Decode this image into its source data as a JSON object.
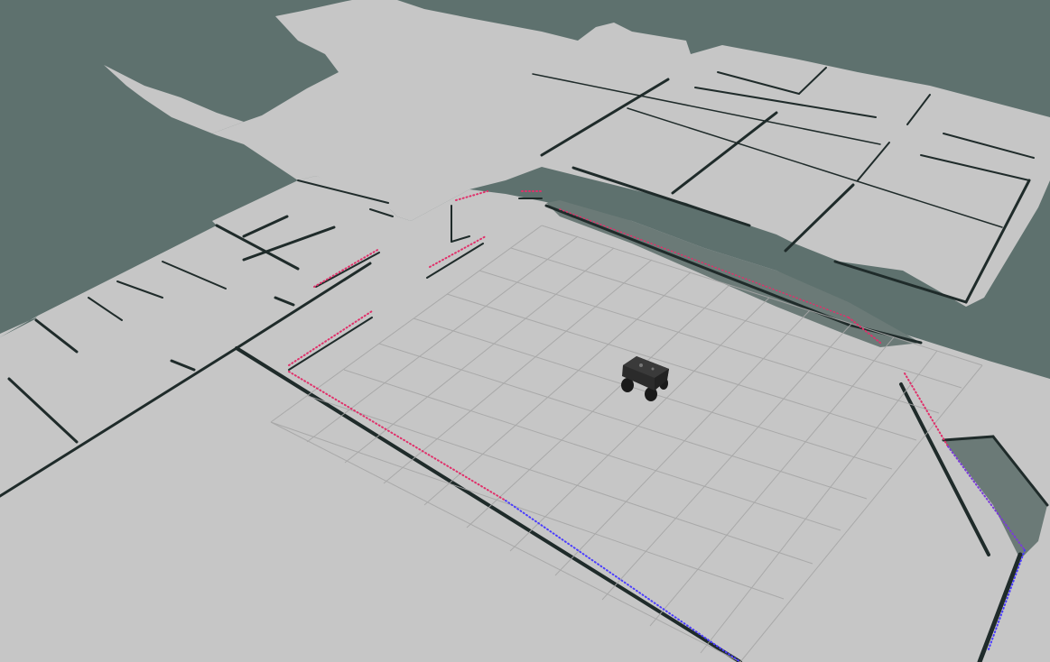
{
  "viewport": {
    "kind": "3d-map-visualization",
    "has_text": false
  },
  "colors": {
    "unknown": "#5e716e",
    "free": "#c6c6c6",
    "wall": "#1f2b2a",
    "grid": "#a6a6a6",
    "scan_red": "#e0306a",
    "scan_blue": "#4a3cff",
    "robot_body": "#2b2b2b",
    "robot_top": "#3a3a3a"
  },
  "scene": {
    "map": "occupancy-grid",
    "grid": "reference-grid",
    "robot": "mobile-robot-model",
    "laser_scan": "laser-scan-points"
  }
}
